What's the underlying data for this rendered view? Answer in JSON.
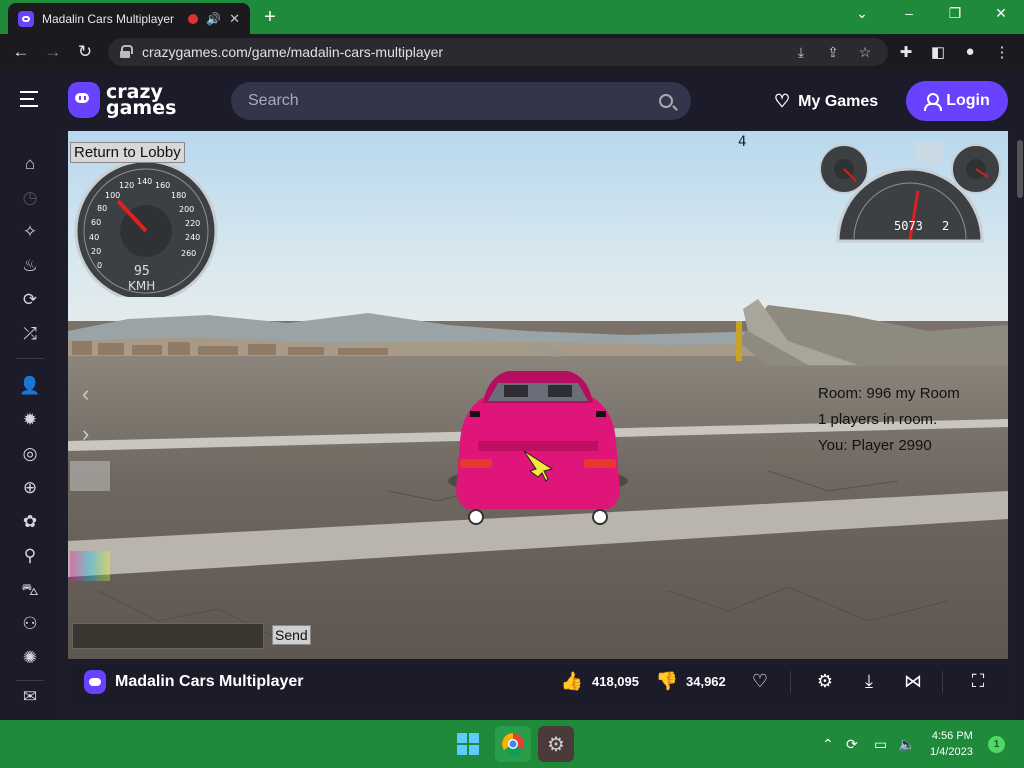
{
  "browser": {
    "tab_title": "Madalin Cars Multiplayer",
    "url": "crazygames.com/game/madalin-cars-multiplayer"
  },
  "site": {
    "logo_top": "crazy",
    "logo_bottom": "games",
    "search_placeholder": "Search",
    "my_games_label": "My Games",
    "login_label": "Login"
  },
  "sidebar": {
    "icons": [
      "home-icon",
      "history-icon",
      "sparkle-icon",
      "flame-icon",
      "refresh-icon",
      "shuffle-icon",
      "multiplayer-icon",
      "action-icon",
      "compass-icon",
      "basketball-icon",
      "flower-icon",
      "bicycle-icon",
      "car-icon",
      "joystick-icon",
      "firework-icon",
      "mail-icon"
    ]
  },
  "game": {
    "lobby_button": "Return to Lobby",
    "speedometer": {
      "speed": "95",
      "unit": "KMH",
      "ticks": [
        "0",
        "20",
        "40",
        "60",
        "80",
        "100",
        "120",
        "140",
        "160",
        "180",
        "200",
        "220",
        "240",
        "260"
      ]
    },
    "tachometer": {
      "rpm": "5073",
      "gear": "2"
    },
    "gear_indicator": "4",
    "room_info": {
      "room": "Room: 996 my Room",
      "players": "1 players in room.",
      "you": "You: Player 2990"
    },
    "chat_send": "Send"
  },
  "game_footer": {
    "title": "Madalin Cars Multiplayer",
    "likes": "418,095",
    "dislikes": "34,962"
  },
  "taskbar": {
    "time": "4:56 PM",
    "date": "1/4/2023",
    "notification_count": "1"
  },
  "colors": {
    "brand": "#6842ff",
    "taskbar": "#1e8a3a",
    "header_bg": "#1b1b2a"
  }
}
